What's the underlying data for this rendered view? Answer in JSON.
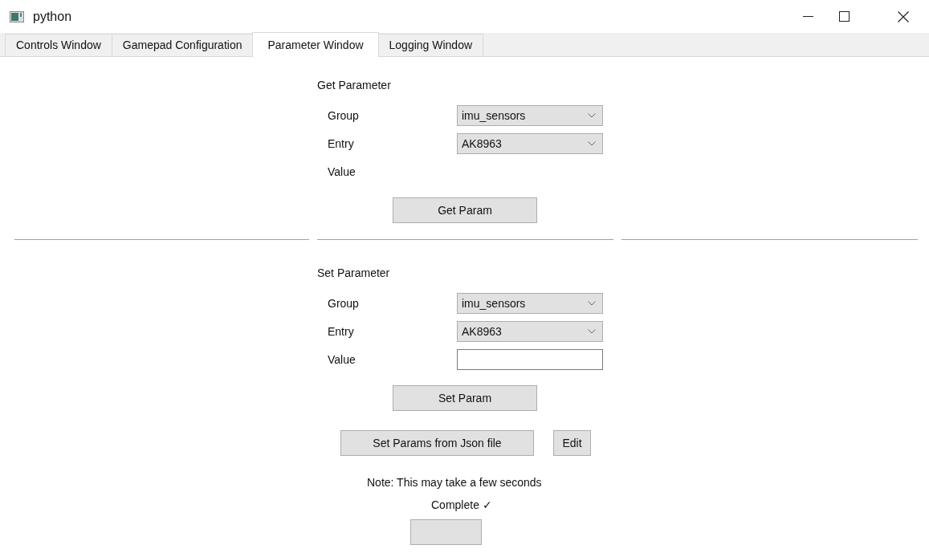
{
  "window": {
    "title": "python"
  },
  "tabs": [
    {
      "label": "Controls Window",
      "selected": false
    },
    {
      "label": "Gamepad Configuration",
      "selected": false
    },
    {
      "label": "Parameter Window",
      "selected": true
    },
    {
      "label": "Logging Window",
      "selected": false
    }
  ],
  "get_parameter": {
    "title": "Get Parameter",
    "fields": [
      {
        "label": "Group",
        "kind": "dropdown",
        "value": "imu_sensors"
      },
      {
        "label": "Entry",
        "kind": "dropdown",
        "value": "AK8963"
      },
      {
        "label": "Value",
        "kind": "readout"
      }
    ],
    "button": "Get Param"
  },
  "set_parameter": {
    "title": "Set Parameter",
    "fields": [
      {
        "label": "Group",
        "kind": "dropdown",
        "value": "imu_sensors"
      },
      {
        "label": "Entry",
        "kind": "dropdown",
        "value": "AK8963"
      },
      {
        "label": "Value",
        "kind": "input"
      }
    ],
    "button": "Set Param"
  },
  "json_buttons": [
    "Set Params from Json file",
    "Edit"
  ],
  "note": "Note: This may take a few seconds",
  "status": "Complete ✓"
}
